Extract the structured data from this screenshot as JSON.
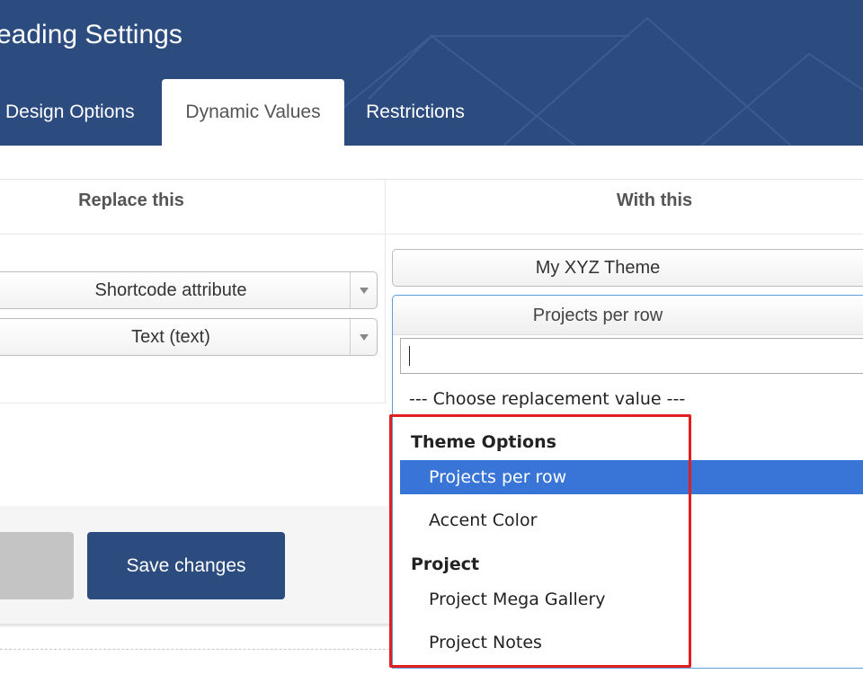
{
  "header": {
    "title": "eading Settings",
    "tabs": [
      {
        "label": "Design Options",
        "active": false
      },
      {
        "label": "Dynamic Values",
        "active": true
      },
      {
        "label": "Restrictions",
        "active": false
      }
    ]
  },
  "table": {
    "headers": {
      "left": "Replace this",
      "right": "With this"
    }
  },
  "replace": {
    "type_select": "Shortcode attribute",
    "attr_select": "Text (text)"
  },
  "with": {
    "source_button": "My XYZ Theme",
    "dropdown": {
      "selected": "Projects per row",
      "search_value": "",
      "placeholder_option": "--- Choose replacement value ---",
      "groups": [
        {
          "label": "Theme Options",
          "options": [
            "Projects per row",
            "Accent Color"
          ]
        },
        {
          "label": "Project",
          "options": [
            "Project Mega Gallery",
            "Project Notes"
          ]
        }
      ],
      "highlighted": "Projects per row"
    }
  },
  "footer": {
    "save_label": "Save changes"
  },
  "colors": {
    "header_bg": "#2c4c7f",
    "highlight": "#3875d7",
    "annotation": "#e02020"
  }
}
